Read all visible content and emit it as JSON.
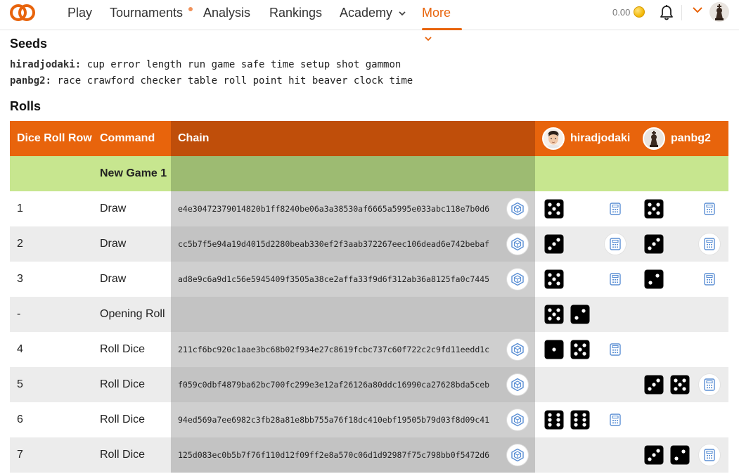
{
  "nav": {
    "items": [
      {
        "label": "Play"
      },
      {
        "label": "Tournaments"
      },
      {
        "label": "Analysis"
      },
      {
        "label": "Rankings"
      },
      {
        "label": "Academy"
      },
      {
        "label": "More"
      }
    ],
    "balance": "0.00",
    "accent": "#e8640c"
  },
  "seeds": {
    "title": "Seeds",
    "lines": [
      {
        "player": "hiradjodaki:",
        "words": "cup error length run game safe time setup shot gammon"
      },
      {
        "player": "panbg2:",
        "words": "race crawford checker table roll point hit beaver clock time"
      }
    ]
  },
  "rolls": {
    "title": "Rolls",
    "headers": {
      "row": "Dice Roll Row",
      "command": "Command",
      "chain": "Chain",
      "player1": "hiradjodaki",
      "player2": "panbg2"
    },
    "game_label": "New Game 1",
    "rows": [
      {
        "row": "1",
        "command": "Draw",
        "chain": "e4e30472379014820b1ff8240be06a3a38530af6665a5995e033abc118e7b0d6",
        "p1": [
          5
        ],
        "p2": [
          5
        ]
      },
      {
        "row": "2",
        "command": "Draw",
        "chain": "cc5b7f5e94a19d4015d2280beab330ef2f3aab372267eec106dead6e742bebaf",
        "p1": [
          3
        ],
        "p2": [
          3
        ]
      },
      {
        "row": "3",
        "command": "Draw",
        "chain": "ad8e9c6a9d1c56e5945409f3505a38ce2affa33f9d6f312ab36a8125fa0c7445",
        "p1": [
          5
        ],
        "p2": [
          2
        ]
      },
      {
        "row": "-",
        "command": "Opening Roll",
        "chain": "",
        "p1": [
          5,
          2
        ],
        "p2": []
      },
      {
        "row": "4",
        "command": "Roll Dice",
        "chain": "211cf6bc920c1aae3bc68b02f934e27c8619fcbc737c60f722c2c9fd11eedd1c",
        "p1": [
          1,
          5
        ],
        "p2": []
      },
      {
        "row": "5",
        "command": "Roll Dice",
        "chain": "f059c0dbf4879ba62bc700fc299e3e12af26126a80ddc16990ca27628bda5ceb",
        "p1": [],
        "p2": [
          3,
          5
        ]
      },
      {
        "row": "6",
        "command": "Roll Dice",
        "chain": "94ed569a7ee6982c3fb28a81e8bb755a76f18dc410ebf19505b79d03f8d09c41",
        "p1": [
          6,
          6
        ],
        "p2": []
      },
      {
        "row": "7",
        "command": "Roll Dice",
        "chain": "125d083ec0b5b7f76f110d12f09ff2e8a570c06d1d92987f75c798bb0f5472d6",
        "p1": [],
        "p2": [
          3,
          2
        ]
      }
    ]
  }
}
